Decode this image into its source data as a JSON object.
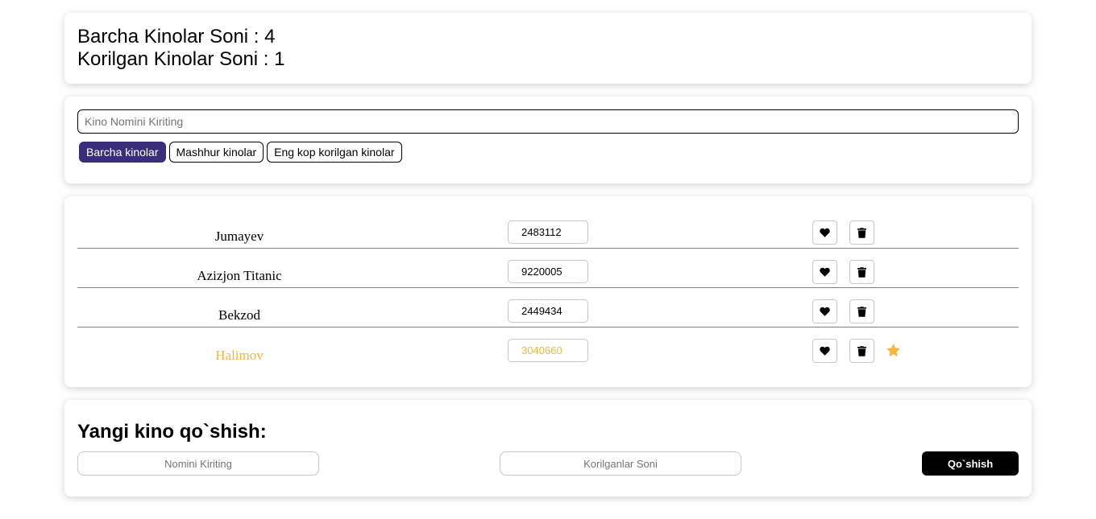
{
  "stats": {
    "total_label": "Barcha Kinolar Soni : 4",
    "watched_label": "Korilgan Kinolar Soni : 1"
  },
  "search": {
    "placeholder": "Kino Nomini Kiriting",
    "value": ""
  },
  "filters": [
    {
      "label": "Barcha kinolar",
      "active": true
    },
    {
      "label": "Mashhur kinolar",
      "active": false
    },
    {
      "label": "Eng kop korilgan kinolar",
      "active": false
    }
  ],
  "movies": [
    {
      "name": "Jumayev",
      "views": "2483112",
      "favorite": false
    },
    {
      "name": "Azizjon Titanic",
      "views": "9220005",
      "favorite": false
    },
    {
      "name": "Bekzod",
      "views": "2449434",
      "favorite": false
    },
    {
      "name": "Halimov",
      "views": "3040660",
      "favorite": true
    }
  ],
  "icons": {
    "like": "heart-icon",
    "delete": "trash-icon",
    "favorite": "star-icon"
  },
  "colors": {
    "accent": "#3a2e7a",
    "favorite": "#f4b63f",
    "submit": "#000000"
  },
  "add_form": {
    "title": "Yangi kino qo`shish:",
    "name_placeholder": "Nomini Kiriting",
    "count_placeholder": "Korilganlar Soni",
    "submit_label": "Qo`shish"
  }
}
